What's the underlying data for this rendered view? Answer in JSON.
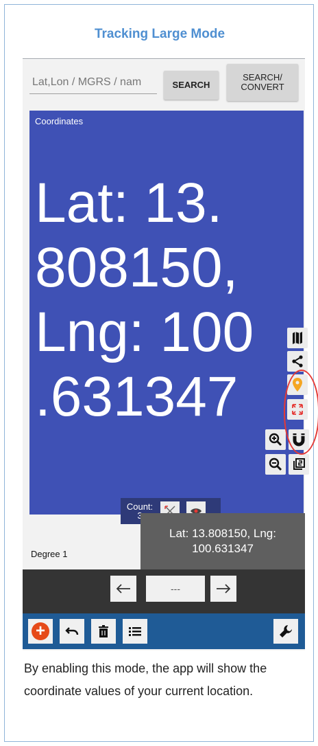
{
  "heading": "Tracking Large Mode",
  "search": {
    "placeholder": "Lat,Lon / MGRS / nam",
    "search_label": "SEARCH",
    "convert_label_line1": "SEARCH/",
    "convert_label_line2": "CONVERT"
  },
  "panel": {
    "title": "Coordinates",
    "big_lines": [
      "Lat: 13.",
      "808150,",
      "Lng: 100",
      ".631347"
    ]
  },
  "count": {
    "label": "Count:",
    "value": "3"
  },
  "degree_label": "Degree 1",
  "toast_text": "Lat: 13.808150, Lng: 100.631347",
  "nav": {
    "center_label": "---"
  },
  "description": "By enabling this mode, the app will show the coordinate values of your current location.",
  "colors": {
    "heading": "#4f8fd1",
    "panel_bg": "#3f51b5",
    "toolbar_bg": "#1f5b96",
    "marker": "#f5a623",
    "highlight": "#e53935",
    "add_button": "#e64a19"
  }
}
